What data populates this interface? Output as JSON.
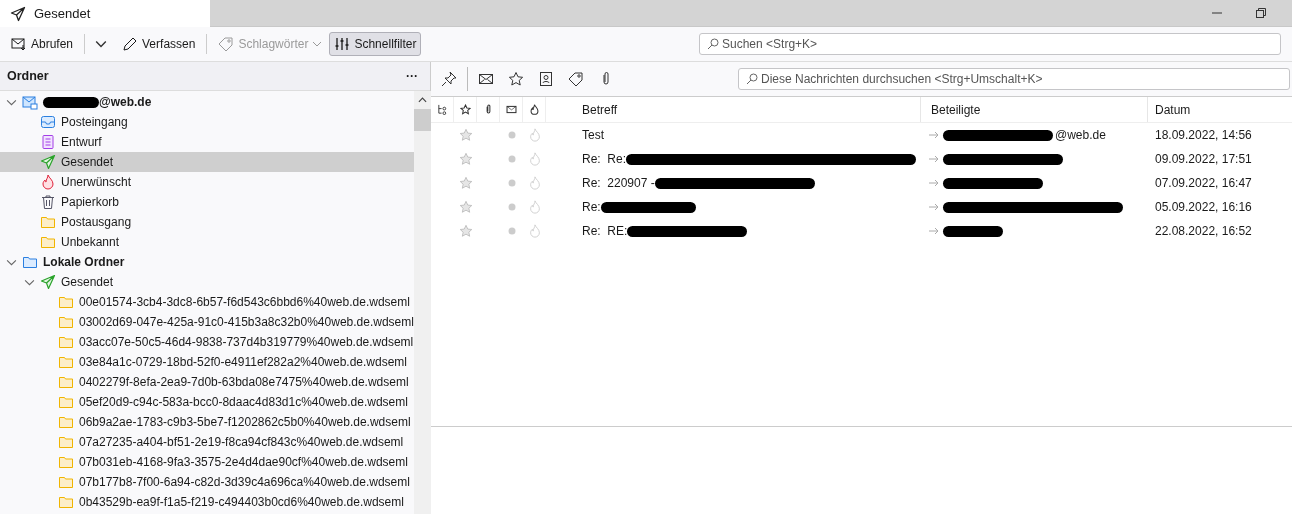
{
  "tab": {
    "title": "Gesendet"
  },
  "toolbar": [
    {
      "kind": "get",
      "label": "Abrufen",
      "disabled": false,
      "pressed": false
    },
    {
      "kind": "write",
      "label": "Verfassen",
      "disabled": false,
      "pressed": false
    },
    {
      "kind": "tags",
      "label": "Schlagwörter",
      "disabled": true,
      "pressed": false
    },
    {
      "kind": "filter",
      "label": "Schnellfilter",
      "disabled": false,
      "pressed": true
    }
  ],
  "search": {
    "placeholder": "Suchen <Strg+K>"
  },
  "folder_pane": {
    "title": "Ordner",
    "menu": "···",
    "tree": [
      {
        "kind": "account",
        "label": "@web.de",
        "redacted": true,
        "bold": true,
        "selected": false,
        "expanded": true,
        "children": [
          {
            "kind": "inbox",
            "label": "Posteingang",
            "selected": false
          },
          {
            "kind": "drafts",
            "label": "Entwurf",
            "selected": false
          },
          {
            "kind": "sent",
            "label": "Gesendet",
            "selected": true
          },
          {
            "kind": "junk",
            "label": "Unerwünscht",
            "selected": false
          },
          {
            "kind": "trash",
            "label": "Papierkorb",
            "selected": false
          },
          {
            "kind": "folder",
            "label": "Postausgang",
            "selected": false
          },
          {
            "kind": "folder",
            "label": "Unbekannt",
            "selected": false
          }
        ]
      },
      {
        "kind": "local",
        "label": "Lokale Ordner",
        "bold": true,
        "selected": false,
        "expanded": true,
        "children": [
          {
            "kind": "sent",
            "label": "Gesendet",
            "selected": false,
            "expanded": true,
            "children": [
              {
                "kind": "folder",
                "label": "00e01574-3cb4-3dc8-6b57-f6d543c6bbd6%40web.de.wdseml",
                "selected": false
              },
              {
                "kind": "folder",
                "label": "03002d69-047e-425a-91c0-415b3a8c32b0%40web.de.wdseml",
                "selected": false
              },
              {
                "kind": "folder",
                "label": "03acc07e-50c5-46d4-9838-737d4b319779%40web.de.wdseml",
                "selected": false
              },
              {
                "kind": "folder",
                "label": "03e84a1c-0729-18bd-52f0-e4911ef282a2%40web.de.wdseml",
                "selected": false
              },
              {
                "kind": "folder",
                "label": "0402279f-8efa-2ea9-7d0b-63bda08e7475%40web.de.wdseml",
                "selected": false
              },
              {
                "kind": "folder",
                "label": "05ef20d9-c94c-583a-bcc0-8daac4d83d1c%40web.de.wdseml",
                "selected": false
              },
              {
                "kind": "folder",
                "label": "06b9a2ae-1783-c9b3-5be7-f1202862c5b0%40web.de.wdseml",
                "selected": false
              },
              {
                "kind": "folder",
                "label": "07a27235-a404-bf51-2e19-f8ca94cf843c%40web.de.wdseml",
                "selected": false
              },
              {
                "kind": "folder",
                "label": "07b031eb-4168-9fa3-3575-2e4d4dae90cf%40web.de.wdseml",
                "selected": false
              },
              {
                "kind": "folder",
                "label": "07b177b8-7f00-6a94-c82d-3d39c4a696ca%40web.de.wdseml",
                "selected": false
              },
              {
                "kind": "folder",
                "label": "0b43529b-ea9f-f1a5-f219-c494403b0cd6%40web.de.wdseml",
                "selected": false
              }
            ]
          }
        ]
      }
    ]
  },
  "message_search": {
    "placeholder": "Diese Nachrichten durchsuchen <Strg+Umschalt+K>"
  },
  "columns": {
    "subject": "Betreff",
    "correspondents": "Beteiligte",
    "date": "Datum"
  },
  "messages": [
    {
      "subject": "Test",
      "subject_redacted": false,
      "correspondent": "@web.de",
      "correspondent_redacted": true,
      "date": "18.09.2022, 14:56",
      "starred": false,
      "unread": false
    },
    {
      "subject": "Re:  Re:",
      "subject_redacted": true,
      "correspondent_redacted": true,
      "date": "09.09.2022, 17:51",
      "starred": false,
      "unread": false
    },
    {
      "subject": "Re:  220907 -",
      "subject_redacted": true,
      "correspondent_redacted": true,
      "date": "07.09.2022, 16:47",
      "starred": false,
      "unread": false
    },
    {
      "subject": "Re:",
      "subject_redacted": true,
      "correspondent_redacted": true,
      "date": "05.09.2022, 16:16",
      "starred": false,
      "unread": false
    },
    {
      "subject": "Re:  RE:",
      "subject_redacted": true,
      "correspondent_redacted": true,
      "date": "22.08.2022, 16:52",
      "starred": false,
      "unread": false
    }
  ]
}
